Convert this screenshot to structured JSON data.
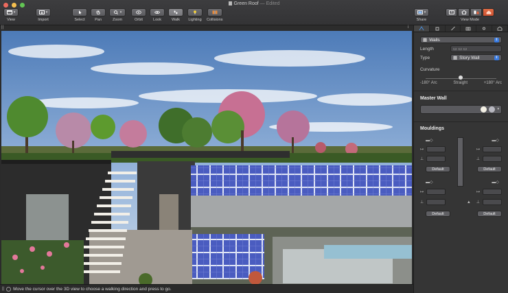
{
  "window": {
    "title": "Green Roof",
    "status": "— Edited"
  },
  "toolbar": {
    "view": "View",
    "import": "Import",
    "select": "Select",
    "pan": "Pan",
    "zoom": "Zoom",
    "orbit": "Orbit",
    "look": "Look",
    "walk": "Walk",
    "lighting": "Lighting",
    "collisions": "Collisions",
    "share": "Share",
    "view_mode": "View Mode"
  },
  "statusbar": {
    "message": "Move the cursor over the 3D view to choose a walking direction and press to go."
  },
  "inspector": {
    "object_select": "Walls",
    "length_label": "Length",
    "type_label": "Type",
    "type_value": "Story Wall",
    "curvature_label": "Curvature",
    "curv_left": "-180° Arc",
    "curv_mid": "Straight",
    "curv_right": "+180° Arc",
    "master_wall": "Master Wall",
    "mouldings": "Mouldings",
    "default_btn_1": "Default",
    "default_btn_2": "Default",
    "default_btn_3": "Default",
    "default_btn_4": "Default"
  },
  "colors": {
    "accent": "#3a7be0",
    "active_mode": "#e4623c"
  }
}
